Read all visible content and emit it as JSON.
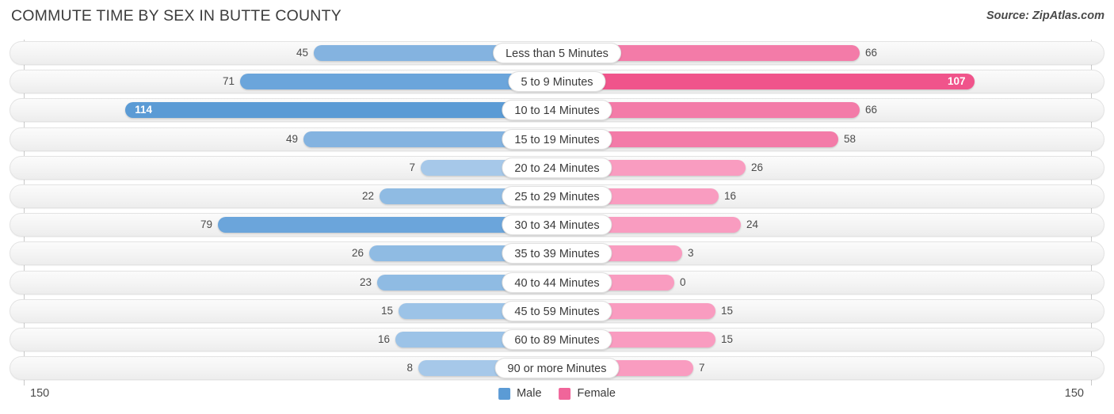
{
  "header": {
    "title": "COMMUTE TIME BY SEX IN BUTTE COUNTY",
    "source": "Source: ZipAtlas.com"
  },
  "axis": {
    "left_cap": "150",
    "right_cap": "150",
    "max": 150
  },
  "legend": [
    {
      "label": "Male",
      "color": "#5b9bd5"
    },
    {
      "label": "Female",
      "color": "#f0659a"
    }
  ],
  "colors": {
    "male_strong": "#5b9bd5",
    "male_mid": "#84b3e0",
    "male_light": "#a6c8e9",
    "female_strong": "#f0548b",
    "female_mid": "#f37ba8",
    "female_light": "#f99cc0",
    "track": "#f4f4f4",
    "axis": "#c9c9c9"
  },
  "chart_data": {
    "type": "bar",
    "title": "COMMUTE TIME BY SEX IN BUTTE COUNTY",
    "orientation": "horizontal-diverging",
    "xlabel": "",
    "ylabel": "",
    "xlim": [
      -150,
      150
    ],
    "grid": false,
    "legend_position": "bottom-center",
    "categories": [
      "Less than 5 Minutes",
      "5 to 9 Minutes",
      "10 to 14 Minutes",
      "15 to 19 Minutes",
      "20 to 24 Minutes",
      "25 to 29 Minutes",
      "30 to 34 Minutes",
      "35 to 39 Minutes",
      "40 to 44 Minutes",
      "45 to 59 Minutes",
      "60 to 89 Minutes",
      "90 or more Minutes"
    ],
    "series": [
      {
        "name": "Male",
        "values": [
          45,
          71,
          114,
          49,
          7,
          22,
          79,
          26,
          23,
          15,
          16,
          8
        ]
      },
      {
        "name": "Female",
        "values": [
          66,
          107,
          66,
          58,
          26,
          16,
          24,
          3,
          0,
          15,
          15,
          7
        ]
      }
    ]
  },
  "rows": [
    {
      "category": "Less than 5 Minutes",
      "male": "45",
      "female": "66",
      "male_w": 307,
      "female_w": 382,
      "male_color": "#84b3e0",
      "female_color": "#f37ba8",
      "male_inside": false,
      "female_inside": false
    },
    {
      "category": "5 to 9 Minutes",
      "male": "71",
      "female": "107",
      "male_w": 400,
      "female_w": 527,
      "male_color": "#6ba5db",
      "female_color": "#f0548b",
      "male_inside": false,
      "female_inside": true
    },
    {
      "category": "10 to 14 Minutes",
      "male": "114",
      "female": "66",
      "male_w": 545,
      "female_w": 382,
      "male_color": "#5b9bd5",
      "female_color": "#f37ba8",
      "male_inside": true,
      "female_inside": false
    },
    {
      "category": "15 to 19 Minutes",
      "male": "49",
      "female": "58",
      "male_w": 320,
      "female_w": 355,
      "male_color": "#84b3e0",
      "female_color": "#f37ba8",
      "male_inside": false,
      "female_inside": false
    },
    {
      "category": "20 to 24 Minutes",
      "male": "7",
      "female": "26",
      "male_w": 172,
      "female_w": 238,
      "male_color": "#a6c8e9",
      "female_color": "#f99cc0",
      "male_inside": false,
      "female_inside": false
    },
    {
      "category": "25 to 29 Minutes",
      "male": "22",
      "female": "16",
      "male_w": 224,
      "female_w": 204,
      "male_color": "#8fbbe3",
      "female_color": "#f99cc0",
      "male_inside": false,
      "female_inside": false
    },
    {
      "category": "30 to 34 Minutes",
      "male": "79",
      "female": "24",
      "male_w": 428,
      "female_w": 232,
      "male_color": "#6ba5db",
      "female_color": "#f99cc0",
      "male_inside": false,
      "female_inside": false
    },
    {
      "category": "35 to 39 Minutes",
      "male": "26",
      "female": "3",
      "male_w": 237,
      "female_w": 158,
      "male_color": "#8fbbe3",
      "female_color": "#f99cc0",
      "male_inside": false,
      "female_inside": false
    },
    {
      "category": "40 to 44 Minutes",
      "male": "23",
      "female": "0",
      "male_w": 227,
      "female_w": 148,
      "male_color": "#8fbbe3",
      "female_color": "#f99cc0",
      "male_inside": false,
      "female_inside": false
    },
    {
      "category": "45 to 59 Minutes",
      "male": "15",
      "female": "15",
      "male_w": 200,
      "female_w": 200,
      "male_color": "#9cc3e7",
      "female_color": "#f99cc0",
      "male_inside": false,
      "female_inside": false
    },
    {
      "category": "60 to 89 Minutes",
      "male": "16",
      "female": "15",
      "male_w": 204,
      "female_w": 200,
      "male_color": "#9cc3e7",
      "female_color": "#f99cc0",
      "male_inside": false,
      "female_inside": false
    },
    {
      "category": "90 or more Minutes",
      "male": "8",
      "female": "7",
      "male_w": 175,
      "female_w": 172,
      "male_color": "#a6c8e9",
      "female_color": "#f99cc0",
      "male_inside": false,
      "female_inside": false
    }
  ]
}
